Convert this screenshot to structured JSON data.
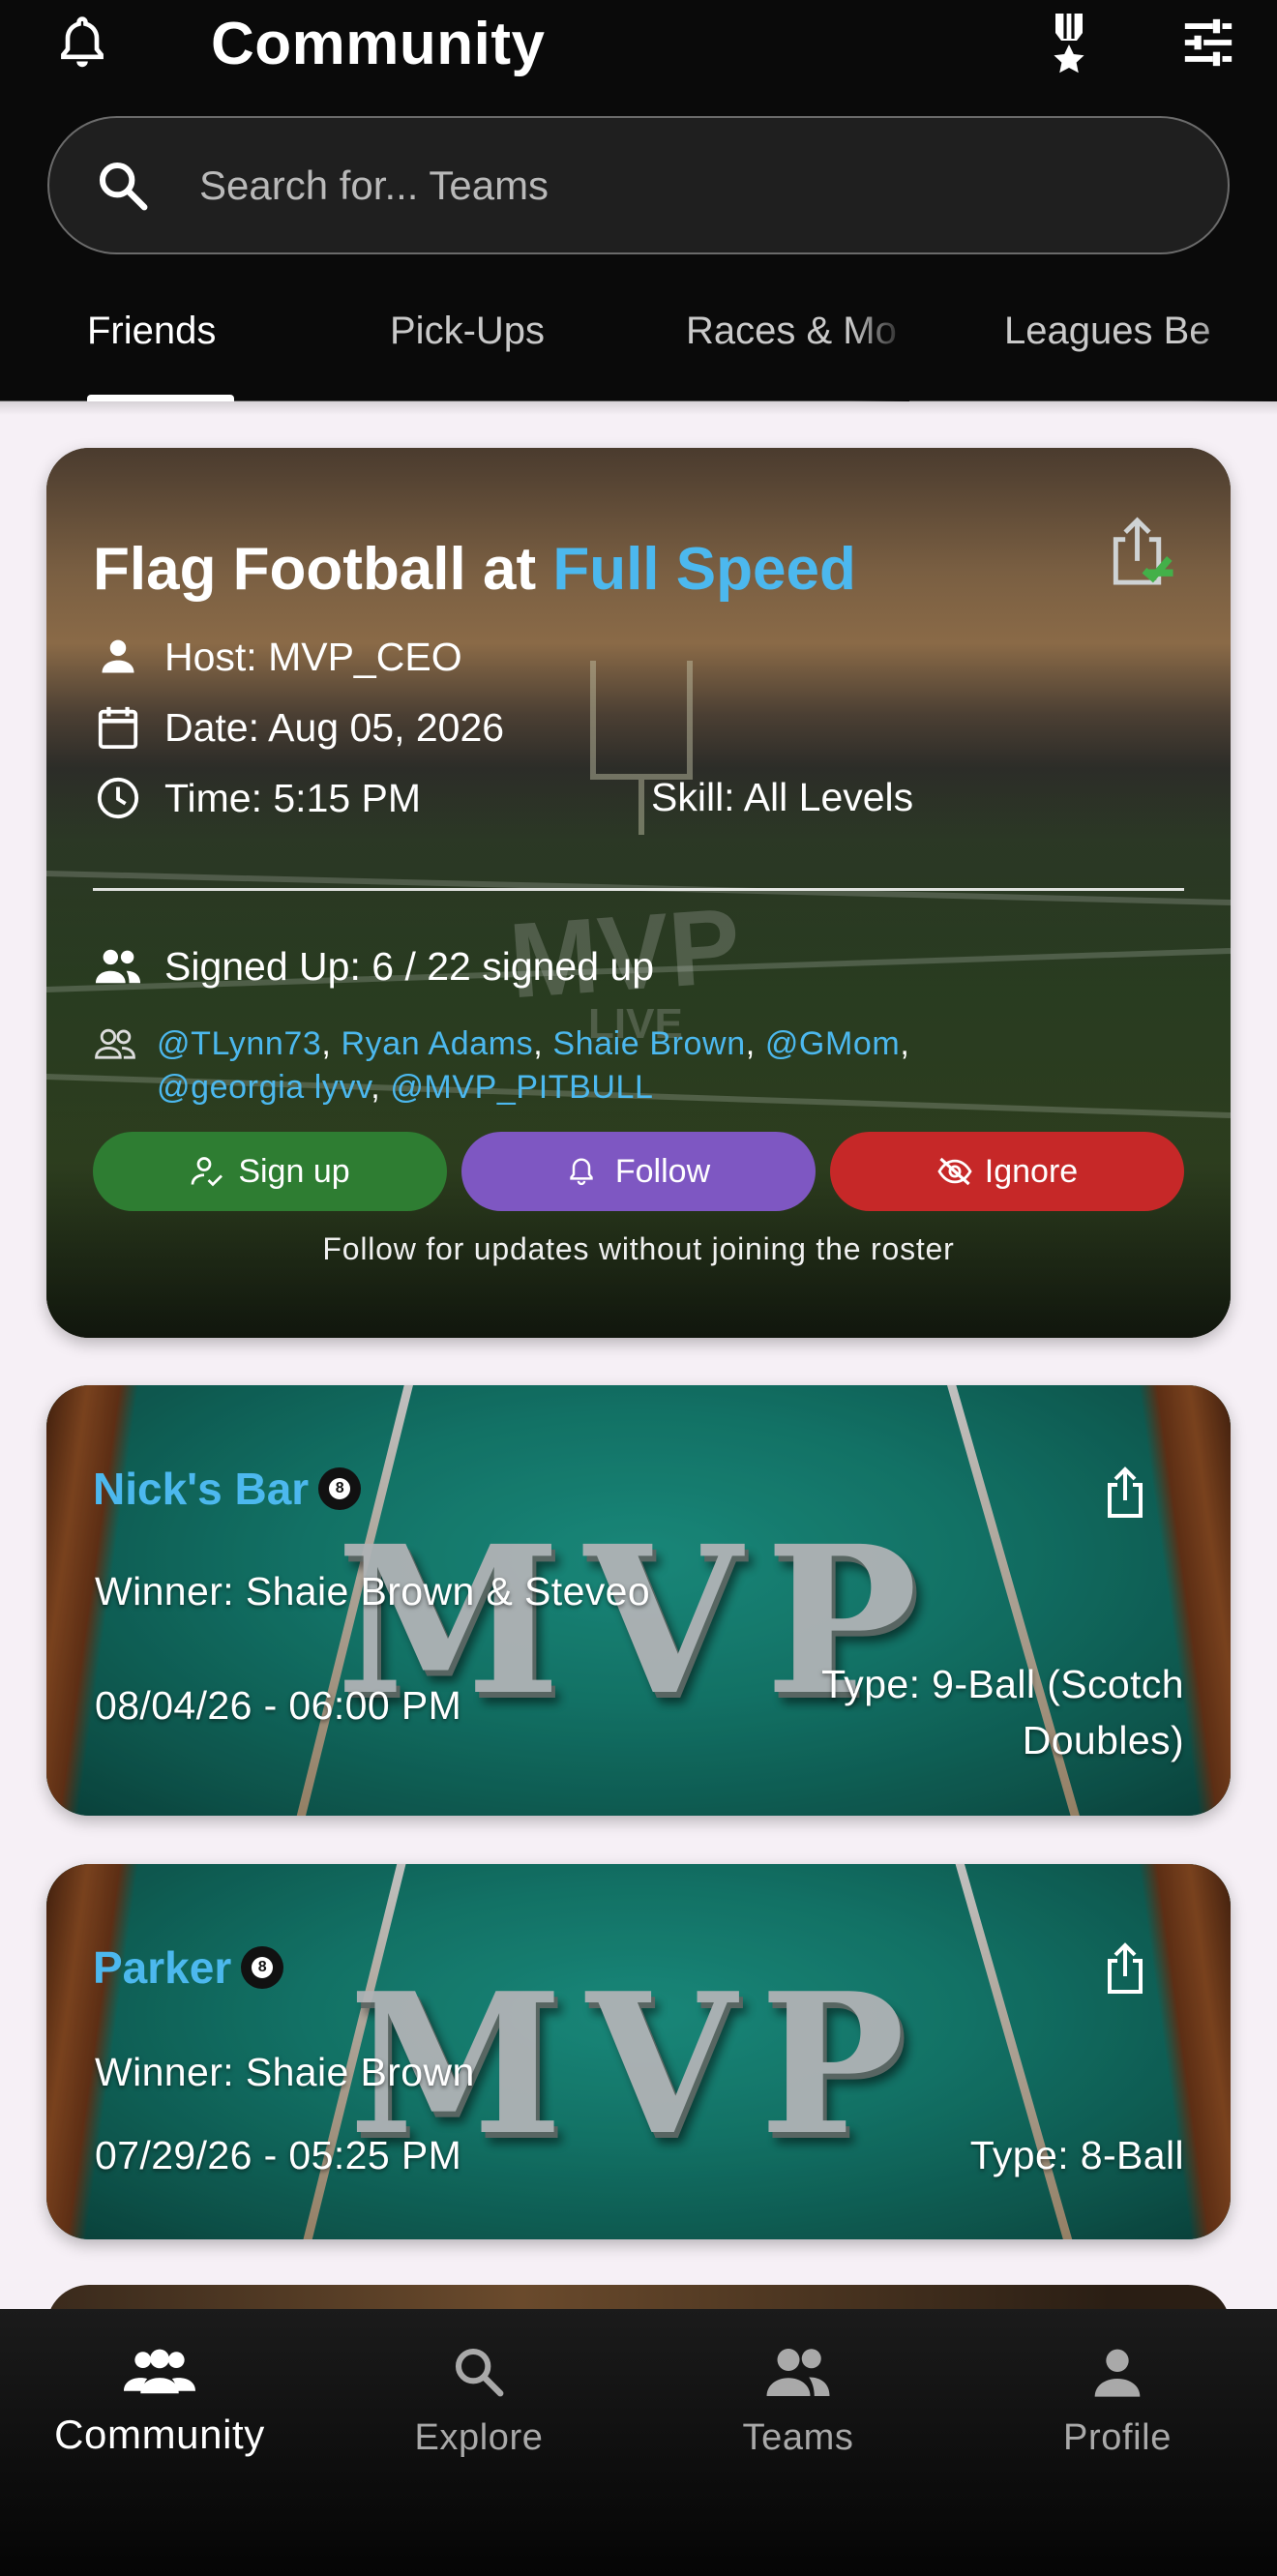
{
  "header": {
    "title": "Community",
    "search_placeholder": "Search for... Teams"
  },
  "tabs": [
    "Friends",
    "Pick-Ups",
    "Races & Mo",
    "Leagues Be"
  ],
  "active_tab": "Friends",
  "event_card": {
    "title_prefix": "Flag Football at ",
    "title_accent": "Full Speed",
    "host": "Host: MVP_CEO",
    "date": "Date: Aug 05, 2026",
    "time": "Time: 5:15 PM",
    "skill": "Skill: All Levels",
    "signed_up": "Signed Up: 6 / 22 signed up",
    "participants": [
      "@TLynn73",
      "Ryan Adams",
      "Shaie Brown",
      "@GMom",
      "@georgia lyvv",
      "@MVP_PITBULL"
    ],
    "actions": {
      "signup": "Sign up",
      "follow": "Follow",
      "ignore": "Ignore"
    },
    "hint": "Follow for updates without joining the roster"
  },
  "results": [
    {
      "venue": "Nick's Bar",
      "winner": "Winner: Shaie Brown & Steveo",
      "datetime": "08/04/26 - 06:00 PM",
      "type_line1": "Type: 9-Ball (Scotch",
      "type_line2": "Doubles)",
      "ball": "8"
    },
    {
      "venue": "Parker",
      "winner": "Winner: Shaie Brown",
      "datetime": "07/29/26 - 05:25 PM",
      "type_line1": "Type: 8-Ball",
      "ball": "8"
    }
  ],
  "backdrop_text": "MVP",
  "field_text": "MVP LIVE",
  "bottom_nav": [
    {
      "label": "Community",
      "icon": "group-icon",
      "active": true
    },
    {
      "label": "Explore",
      "icon": "search-icon",
      "active": false
    },
    {
      "label": "Teams",
      "icon": "teams-icon",
      "active": false
    },
    {
      "label": "Profile",
      "icon": "person-icon",
      "active": false
    }
  ],
  "colors": {
    "accent": "#4cb8ee",
    "signup": "#2e7d32",
    "follow": "#7e57c2",
    "ignore": "#c62828",
    "header_bg": "#0a0a0a"
  }
}
